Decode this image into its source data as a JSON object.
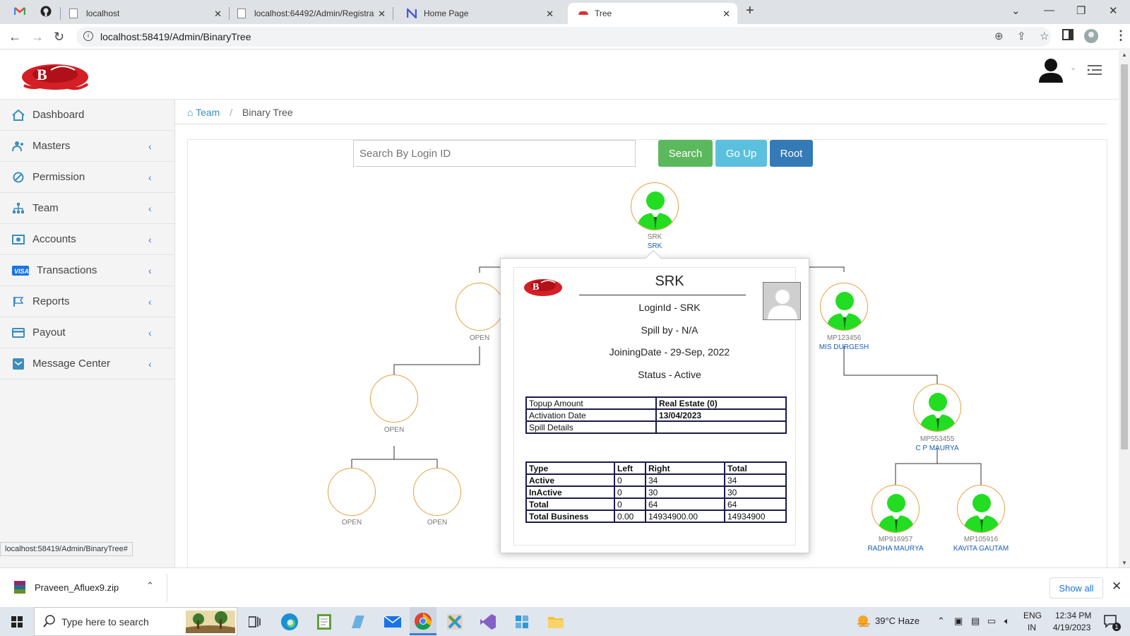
{
  "browser": {
    "tabs": [
      {
        "label": "localhost",
        "active": false
      },
      {
        "label": "localhost:64492/Admin/Registrat",
        "active": false
      },
      {
        "label": "Home Page",
        "active": false
      },
      {
        "label": "Tree",
        "active": true
      }
    ],
    "new_tab_label": "+",
    "url": "localhost:58419/Admin/BinaryTree"
  },
  "sidebar": {
    "items": [
      {
        "label": "Dashboard",
        "icon": "home-icon"
      },
      {
        "label": "Masters",
        "icon": "users-icon"
      },
      {
        "label": "Permission",
        "icon": "ban-icon"
      },
      {
        "label": "Team",
        "icon": "sitemap-icon"
      },
      {
        "label": "Accounts",
        "icon": "money-icon"
      },
      {
        "label": "Transactions",
        "icon": "visa-icon"
      },
      {
        "label": "Reports",
        "icon": "flag-icon"
      },
      {
        "label": "Payout",
        "icon": "card-icon"
      },
      {
        "label": "Message Center",
        "icon": "envelope-icon"
      }
    ]
  },
  "breadcrumb": {
    "home": "Team",
    "current": "Binary Tree"
  },
  "search": {
    "placeholder": "Search By Login ID",
    "search_label": "Search",
    "goup_label": "Go Up",
    "root_label": "Root"
  },
  "tree": {
    "root": {
      "id": "SRK",
      "name": "SRK"
    },
    "l1_left": {
      "status": "OPEN"
    },
    "l1_right": {
      "id": "MP123456",
      "name": "MIS DURGESH"
    },
    "l2_left": {
      "status": "OPEN"
    },
    "l2_rr": {
      "id": "MP553455",
      "name": "C P MAURYA"
    },
    "l3_ll": {
      "status": "OPEN"
    },
    "l3_lr": {
      "status": "OPEN"
    },
    "l3_rrl": {
      "id": "MP916957",
      "name": "RADHA MAURYA"
    },
    "l3_rrr": {
      "id": "MP105916",
      "name": "KAVITA GAUTAM"
    }
  },
  "popup": {
    "title": "SRK",
    "login": "LoginId - SRK",
    "spill": "Spill by - N/A",
    "joining": "JoiningDate - 29-Sep, 2022",
    "status": "Status - Active",
    "info_table": [
      [
        "Topup Amount",
        "Real Estate (0)"
      ],
      [
        "Activation Date",
        "13/04/2023"
      ],
      [
        "Spill Details",
        ""
      ]
    ],
    "stats_header": [
      "Type",
      "Left",
      "Right",
      "Total"
    ],
    "stats_rows": [
      [
        "Active",
        "0",
        "34",
        "34"
      ],
      [
        "InActive",
        "0",
        "30",
        "30"
      ],
      [
        "Total",
        "0",
        "64",
        "64"
      ],
      [
        "Total Business",
        "0.00",
        "14934900.00",
        "14934900"
      ]
    ]
  },
  "status_url": "localhost:58419/Admin/BinaryTree#",
  "download": {
    "filename": "Praveen_Afluex9.zip",
    "show_all": "Show all"
  },
  "taskbar": {
    "search_placeholder": "Type here to search",
    "weather": "39°C  Haze",
    "lang1": "ENG",
    "lang2": "IN",
    "time": "12:34 PM",
    "date": "4/19/2023",
    "notif_count": "1"
  },
  "colors": {
    "accent": "#3c8dbc",
    "search_btn": "#5cb85c",
    "goup_btn": "#5bc0de",
    "root_btn": "#337ab7",
    "node_border": "#e6a040",
    "user_green": "#22dd22"
  }
}
